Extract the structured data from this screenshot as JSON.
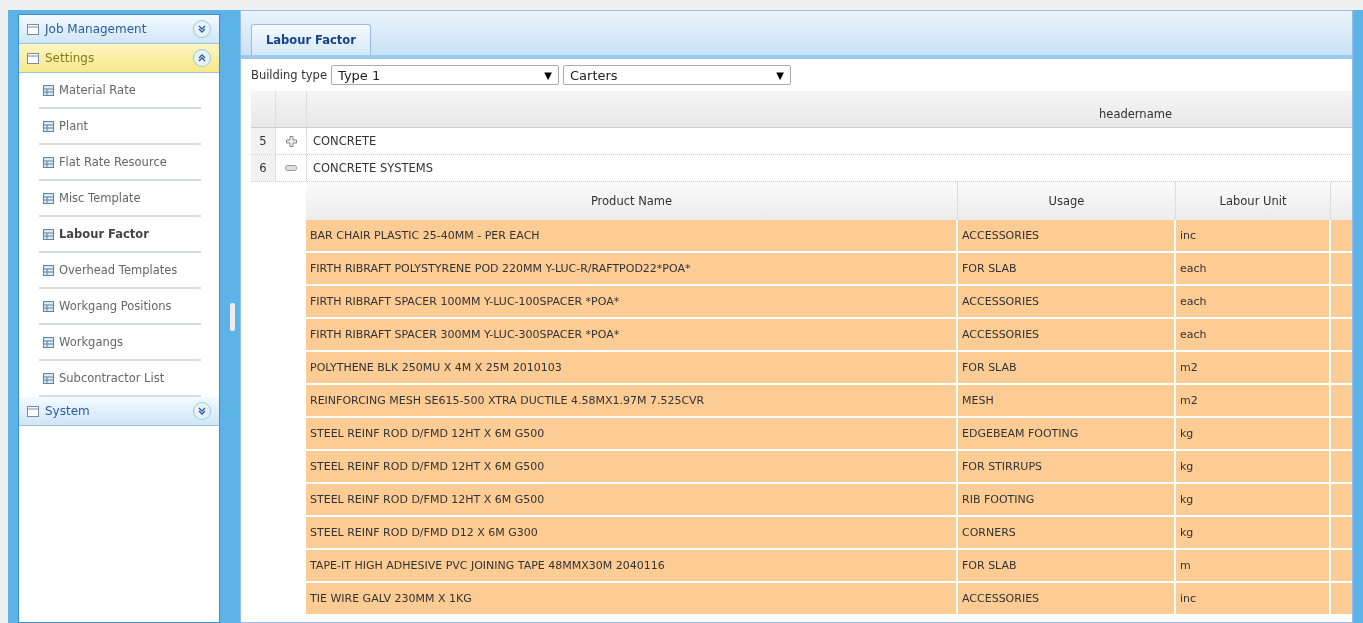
{
  "sidebar": {
    "sections": [
      {
        "title": "Job Management",
        "expanded": false
      },
      {
        "title": "Settings",
        "expanded": true,
        "items": [
          {
            "label": "Material Rate",
            "selected": false
          },
          {
            "label": "Plant",
            "selected": false
          },
          {
            "label": "Flat Rate Resource",
            "selected": false
          },
          {
            "label": "Misc Template",
            "selected": false
          },
          {
            "label": "Labour Factor",
            "selected": true
          },
          {
            "label": "Overhead Templates",
            "selected": false
          },
          {
            "label": "Workgang Positions",
            "selected": false
          },
          {
            "label": "Workgangs",
            "selected": false
          },
          {
            "label": "Subcontractor List",
            "selected": false
          }
        ]
      },
      {
        "title": "System",
        "expanded": false
      }
    ]
  },
  "tabs": [
    {
      "label": "Labour Factor",
      "selected": true
    }
  ],
  "toolbar": {
    "label": "Building type",
    "selects": [
      {
        "value": "Type 1",
        "arrow": "▼"
      },
      {
        "value": "Carters",
        "arrow": "▼"
      }
    ]
  },
  "grid": {
    "header": "headername",
    "groups": [
      {
        "number": "5",
        "name": "CONCRETE",
        "expanded": false
      },
      {
        "number": "6",
        "name": "CONCRETE SYSTEMS",
        "expanded": true
      }
    ]
  },
  "subgrid": {
    "columns": [
      "Product Name",
      "Usage",
      "Labour Unit"
    ],
    "rows": [
      [
        "BAR CHAIR PLASTIC 25-40MM - PER EACH",
        "ACCESSORIES",
        "inc"
      ],
      [
        "FIRTH RIBRAFT POLYSTYRENE POD 220MM Y-LUC-R/RAFTPOD22*POA*",
        "FOR SLAB",
        "each"
      ],
      [
        "FIRTH RIBRAFT SPACER 100MM Y-LUC-100SPACER *POA*",
        "ACCESSORIES",
        "each"
      ],
      [
        "FIRTH RIBRAFT SPACER 300MM Y-LUC-300SPACER *POA*",
        "ACCESSORIES",
        "each"
      ],
      [
        "POLYTHENE BLK 250MU X 4M X 25M 2010103",
        "FOR SLAB",
        "m2"
      ],
      [
        "REINFORCING MESH SE615-500 XTRA DUCTILE 4.58MX1.97M 7.525CVR",
        "MESH",
        "m2"
      ],
      [
        "STEEL REINF ROD D/FMD 12HT X 6M G500",
        "EDGEBEAM FOOTING",
        "kg"
      ],
      [
        "STEEL REINF ROD D/FMD 12HT X 6M G500",
        "FOR STIRRUPS",
        "kg"
      ],
      [
        "STEEL REINF ROD D/FMD 12HT X 6M G500",
        "RIB FOOTING",
        "kg"
      ],
      [
        "STEEL REINF ROD D/FMD D12 X 6M G300",
        "CORNERS",
        "kg"
      ],
      [
        "TAPE-IT HIGH ADHESIVE PVC JOINING TAPE 48MMX30M 2040116",
        "FOR SLAB",
        "m"
      ],
      [
        "TIE WIRE GALV 230MM X 1KG",
        "ACCESSORIES",
        "inc"
      ]
    ]
  }
}
